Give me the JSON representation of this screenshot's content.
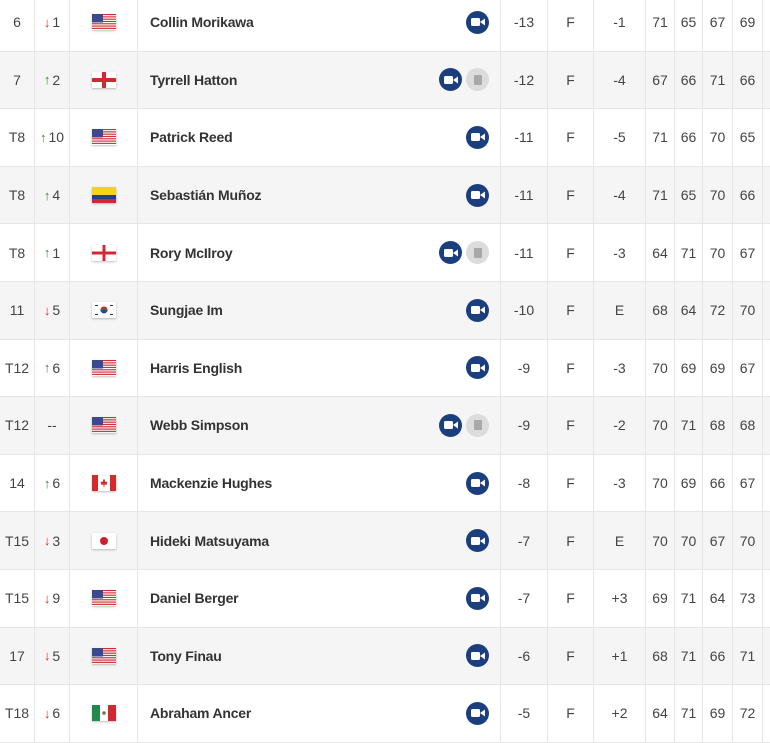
{
  "colors": {
    "up": "#3a8a2a",
    "down": "#d9302a",
    "camera": "#1b3f7e"
  },
  "rows": [
    {
      "pos": "6",
      "dir": "down",
      "move": "1",
      "flag": "usa",
      "name": "Collin Morikawa",
      "audio": false,
      "total": "-13",
      "thru": "F",
      "today": "-1",
      "r1": "71",
      "r2": "65",
      "r3": "67",
      "r4": "69"
    },
    {
      "pos": "7",
      "dir": "up",
      "move": "2",
      "flag": "england",
      "name": "Tyrrell Hatton",
      "audio": true,
      "total": "-12",
      "thru": "F",
      "today": "-4",
      "r1": "67",
      "r2": "66",
      "r3": "71",
      "r4": "66"
    },
    {
      "pos": "T8",
      "dir": "up",
      "move": "10",
      "flag": "usa",
      "name": "Patrick Reed",
      "audio": false,
      "total": "-11",
      "thru": "F",
      "today": "-5",
      "r1": "71",
      "r2": "66",
      "r3": "70",
      "r4": "65"
    },
    {
      "pos": "T8",
      "dir": "up",
      "move": "4",
      "flag": "colombia",
      "name": "Sebastián Muñoz",
      "audio": false,
      "total": "-11",
      "thru": "F",
      "today": "-4",
      "r1": "71",
      "r2": "65",
      "r3": "70",
      "r4": "66"
    },
    {
      "pos": "T8",
      "dir": "up",
      "move": "1",
      "flag": "northern-ireland",
      "name": "Rory McIlroy",
      "audio": true,
      "total": "-11",
      "thru": "F",
      "today": "-3",
      "r1": "64",
      "r2": "71",
      "r3": "70",
      "r4": "67"
    },
    {
      "pos": "11",
      "dir": "down",
      "move": "5",
      "flag": "south-korea",
      "name": "Sungjae Im",
      "audio": false,
      "total": "-10",
      "thru": "F",
      "today": "E",
      "r1": "68",
      "r2": "64",
      "r3": "72",
      "r4": "70"
    },
    {
      "pos": "T12",
      "dir": "up",
      "move": "6",
      "flag": "usa",
      "name": "Harris English",
      "audio": false,
      "total": "-9",
      "thru": "F",
      "today": "-3",
      "r1": "70",
      "r2": "69",
      "r3": "69",
      "r4": "67"
    },
    {
      "pos": "T12",
      "dir": "none",
      "move": "--",
      "flag": "usa",
      "name": "Webb Simpson",
      "audio": true,
      "total": "-9",
      "thru": "F",
      "today": "-2",
      "r1": "70",
      "r2": "71",
      "r3": "68",
      "r4": "68"
    },
    {
      "pos": "14",
      "dir": "up",
      "move": "6",
      "flag": "canada",
      "name": "Mackenzie Hughes",
      "audio": false,
      "total": "-8",
      "thru": "F",
      "today": "-3",
      "r1": "70",
      "r2": "69",
      "r3": "66",
      "r4": "67"
    },
    {
      "pos": "T15",
      "dir": "down",
      "move": "3",
      "flag": "japan",
      "name": "Hideki Matsuyama",
      "audio": false,
      "total": "-7",
      "thru": "F",
      "today": "E",
      "r1": "70",
      "r2": "70",
      "r3": "67",
      "r4": "70"
    },
    {
      "pos": "T15",
      "dir": "down",
      "move": "9",
      "flag": "usa",
      "name": "Daniel Berger",
      "audio": false,
      "total": "-7",
      "thru": "F",
      "today": "+3",
      "r1": "69",
      "r2": "71",
      "r3": "64",
      "r4": "73"
    },
    {
      "pos": "17",
      "dir": "down",
      "move": "5",
      "flag": "usa",
      "name": "Tony Finau",
      "audio": false,
      "total": "-6",
      "thru": "F",
      "today": "+1",
      "r1": "68",
      "r2": "71",
      "r3": "66",
      "r4": "71"
    },
    {
      "pos": "T18",
      "dir": "down",
      "move": "6",
      "flag": "mexico",
      "name": "Abraham Ancer",
      "audio": false,
      "total": "-5",
      "thru": "F",
      "today": "+2",
      "r1": "64",
      "r2": "71",
      "r3": "69",
      "r4": "72"
    }
  ]
}
